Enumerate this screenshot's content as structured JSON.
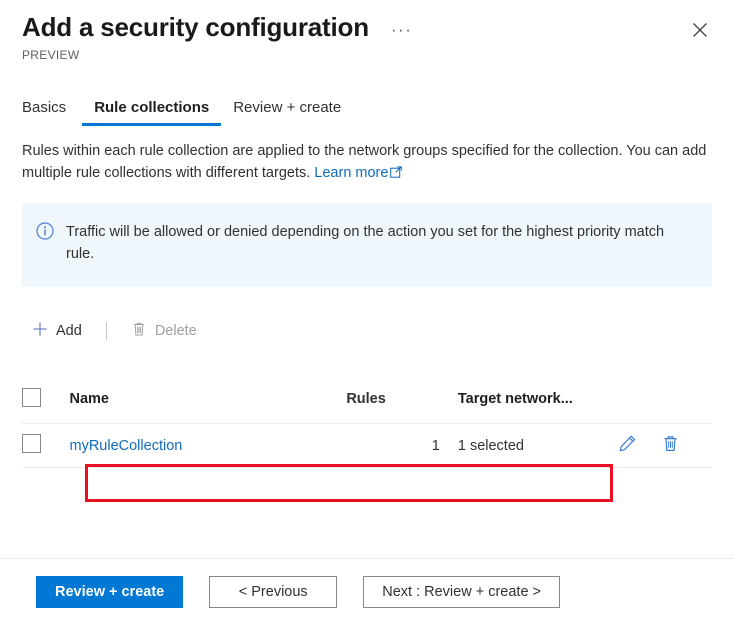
{
  "header": {
    "title": "Add a security configuration",
    "preview_label": "PREVIEW",
    "ellipsis_label": "···",
    "close_label": "Close"
  },
  "tabs": [
    {
      "label": "Basics",
      "active": false
    },
    {
      "label": "Rule collections",
      "active": true
    },
    {
      "label": "Review + create",
      "active": false
    }
  ],
  "description": {
    "text": "Rules within each rule collection are applied to the network groups specified for the collection. You can add multiple rule collections with different targets.",
    "link_label": "Learn more"
  },
  "info_banner": {
    "icon": "info-icon",
    "text": "Traffic will be allowed or denied depending on the action you set for the highest priority match rule.",
    "background": "#eff6fc",
    "accent": "#0f6cbd"
  },
  "command_bar": {
    "add_label": "Add",
    "delete_label": "Delete",
    "delete_disabled": true
  },
  "table": {
    "columns": [
      "Name",
      "Rules",
      "Target network..."
    ],
    "rows": [
      {
        "name": "myRuleCollection",
        "rules": "1",
        "target_networks": "1 selected",
        "highlighted": true
      }
    ]
  },
  "footer": {
    "primary_label": "Review + create",
    "previous_label": "< Previous",
    "next_label": "Next : Review + create >"
  },
  "colors": {
    "accent": "#0078d4",
    "link": "#0f6cbd",
    "highlight": "#e81123",
    "disabled_text": "#a19f9d"
  }
}
